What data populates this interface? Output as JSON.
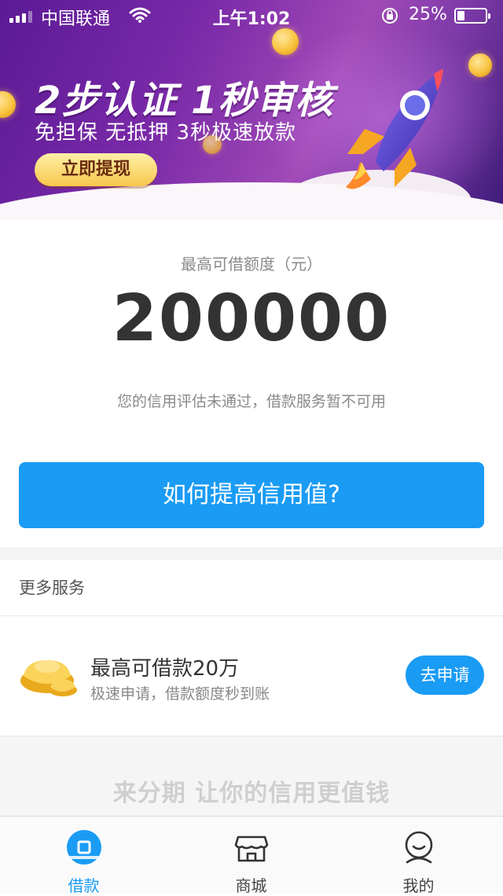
{
  "status_bar": {
    "carrier": "中国联通",
    "time": "上午1:02",
    "battery_percent": "25%",
    "battery_level": 0.25,
    "icons": [
      "signal-icon",
      "wifi-icon",
      "rotation-lock-icon",
      "battery-icon"
    ]
  },
  "banner": {
    "headline": "2步认证 1秒审核",
    "subline": "免担保 无抵押 3秒极速放款",
    "cta_label": "立即提现"
  },
  "limit": {
    "label": "最高可借额度（元）",
    "amount": "200000",
    "note": "您的信用评估未通过，借款服务暂不可用",
    "action_label": "如何提高信用值?"
  },
  "more_services": {
    "title": "更多服务",
    "items": [
      {
        "icon": "gold-ingot-icon",
        "title": "最高可借款20万",
        "subtitle": "极速申请，借款额度秒到账",
        "button_label": "去申请"
      }
    ]
  },
  "slogan": "来分期 让你的信用更值钱",
  "tabbar": {
    "active_index": 0,
    "tabs": [
      {
        "label": "借款",
        "icon": "loan-icon"
      },
      {
        "label": "商城",
        "icon": "store-icon"
      },
      {
        "label": "我的",
        "icon": "profile-icon"
      }
    ]
  },
  "colors": {
    "accent": "#1a9bf4",
    "banner_purple": "#6a2aa0",
    "coin_gold": "#f8c33e"
  }
}
